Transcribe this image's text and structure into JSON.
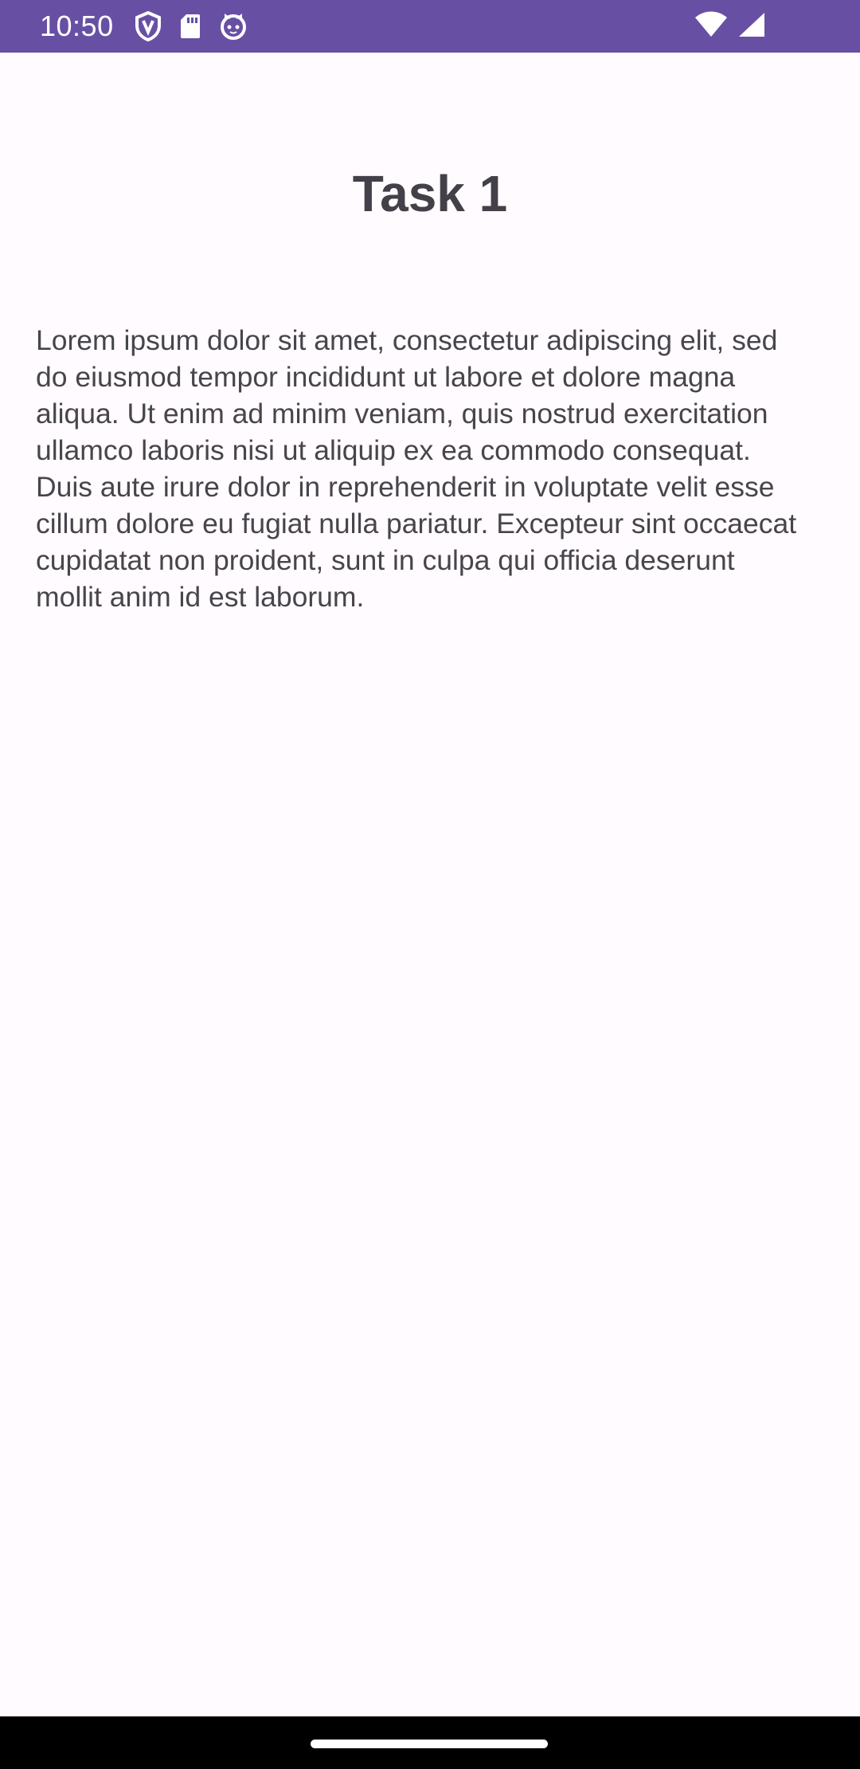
{
  "status_bar": {
    "time": "10:50",
    "background_color": "#6750a4",
    "left_icons": [
      "shield-icon",
      "sd-card-icon",
      "cat-face-icon"
    ],
    "right_icons": [
      "wifi-icon",
      "cellular-signal-icon"
    ]
  },
  "main": {
    "title": "Task 1",
    "body": "Lorem ipsum dolor sit amet, consectetur adipiscing elit, sed do eiusmod tempor incididunt ut labore et dolore magna aliqua. Ut enim ad minim veniam, quis nostrud exercitation ullamco laboris nisi ut aliquip ex ea commodo consequat. Duis aute irure dolor in reprehenderit in voluptate velit esse cillum dolore eu fugiat nulla pariatur. Excepteur sint occaecat cupidatat non proident, sunt in culpa qui officia deserunt mollit anim id est laborum."
  },
  "navigation_bar": {
    "home_indicator": "home-handle-icon"
  }
}
